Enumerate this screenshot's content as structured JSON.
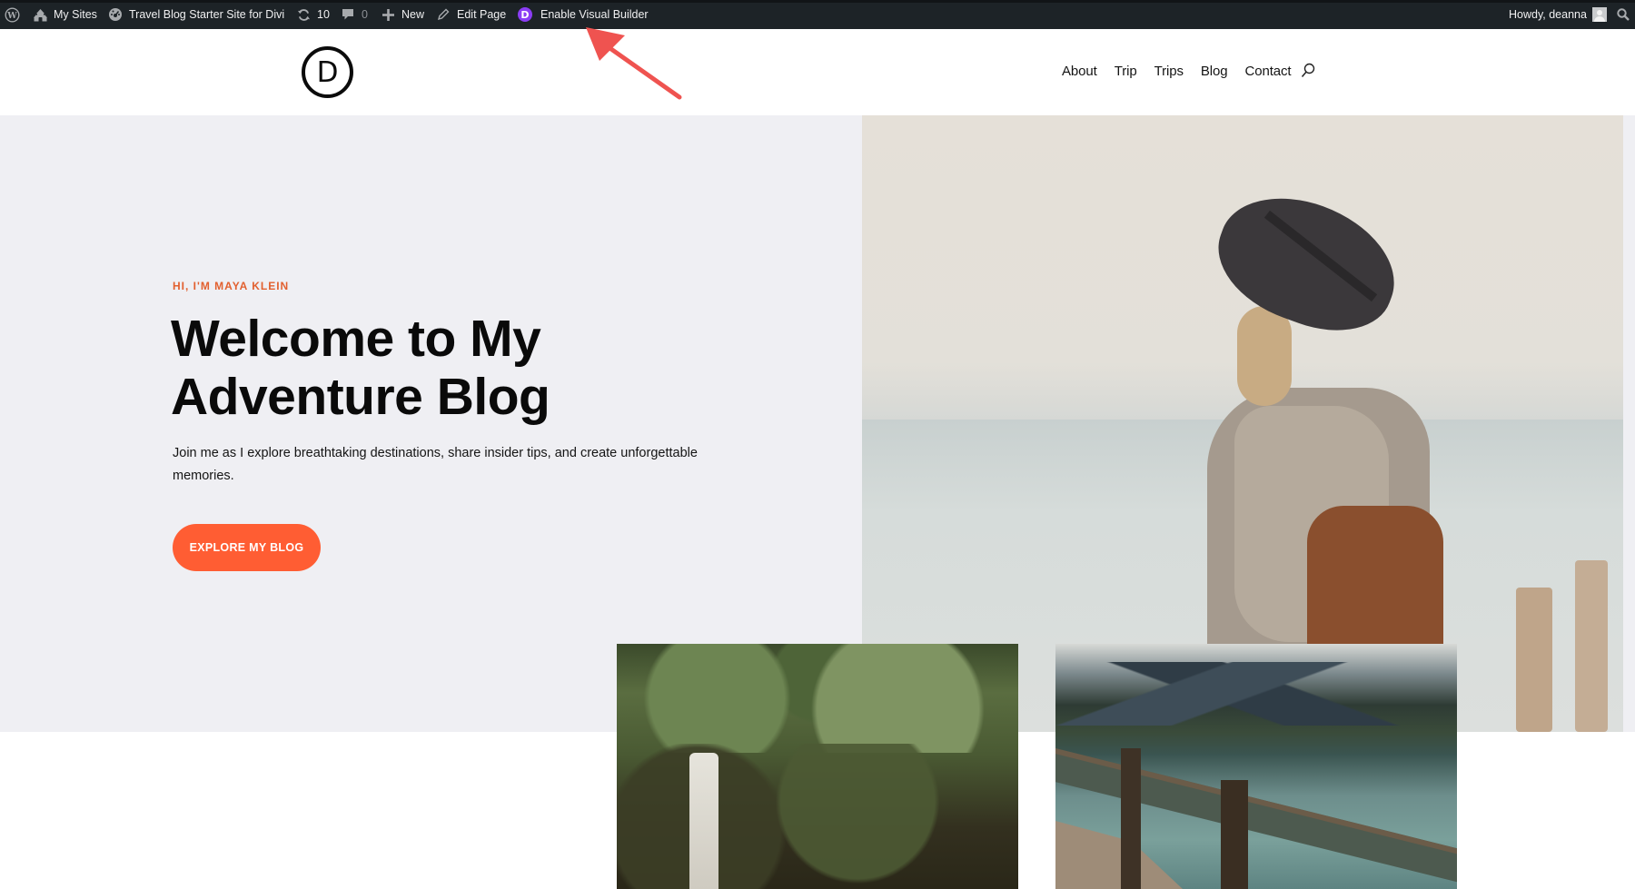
{
  "admin_bar": {
    "wp_logo_icon": "wordpress-logo-icon",
    "my_sites": {
      "icon": "my-sites-icon",
      "label": "My Sites"
    },
    "site": {
      "icon": "dashboard-icon",
      "label": "Travel Blog Starter Site for Divi"
    },
    "updates": {
      "icon": "updates-icon",
      "count": "10"
    },
    "comments": {
      "icon": "comment-icon",
      "count": "0"
    },
    "new": {
      "icon": "plus-icon",
      "label": "New"
    },
    "edit_page": {
      "icon": "pencil-icon",
      "label": "Edit Page"
    },
    "visual_builder": {
      "icon": "divi-icon",
      "badge": "D",
      "label": "Enable Visual Builder"
    },
    "account": {
      "label": "Howdy, deanna",
      "avatar": "avatar"
    },
    "search_icon": "search-icon"
  },
  "header": {
    "logo_letter": "D",
    "nav": [
      {
        "label": "About"
      },
      {
        "label": "Trip"
      },
      {
        "label": "Trips"
      },
      {
        "label": "Blog"
      },
      {
        "label": "Contact"
      }
    ],
    "search_icon": "search-icon"
  },
  "hero": {
    "eyebrow": "HI, I'M MAYA KLEIN",
    "headline_line1": "Welcome to My",
    "headline_line2": "Adventure Blog",
    "description": "Join me as I explore breathtaking destinations, share insider tips, and create unforgettable memories.",
    "cta_label": "EXPLORE MY BLOG",
    "photo": "traveler-in-hat-photo"
  },
  "features": [
    {
      "image": "waterfall-photo"
    },
    {
      "image": "lake-dock-photo"
    }
  ],
  "annotation": {
    "type": "arrow",
    "points_to": "Enable Visual Builder"
  },
  "colors": {
    "admin_bar": "#1d2327",
    "accent": "#ff5d33",
    "eyebrow": "#e2602f",
    "hero_bg": "#efeff3",
    "divi_purple": "#8b3df5",
    "arrow": "#ef5350"
  }
}
